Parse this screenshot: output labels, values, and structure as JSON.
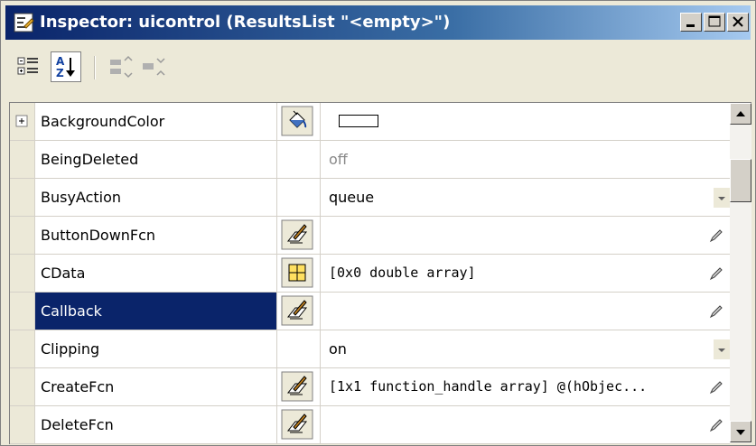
{
  "window": {
    "title": "Inspector:  uicontrol (ResultsList \"<empty>\")",
    "title_icon": "inspector-icon",
    "controls": [
      "minimize-icon",
      "maximize-icon",
      "close-icon"
    ]
  },
  "toolbar": {
    "buttons": [
      {
        "name": "categorized-view-icon",
        "pressed": false
      },
      {
        "name": "alphabetical-sort-icon",
        "pressed": true
      },
      {
        "name": "expand-all-icon",
        "pressed": false
      },
      {
        "name": "collapse-all-icon",
        "pressed": false
      }
    ]
  },
  "properties": [
    {
      "name": "BackgroundColor",
      "expander": "+",
      "icon": "paint-bucket-icon",
      "value": "",
      "swatch": "#ffffff"
    },
    {
      "name": "BeingDeleted",
      "icon": "",
      "value": "off",
      "value_style": "gray"
    },
    {
      "name": "BusyAction",
      "icon": "",
      "value": "queue",
      "dropdown": true
    },
    {
      "name": "ButtonDownFcn",
      "icon": "edit-callback-icon",
      "value": "",
      "pencil": true
    },
    {
      "name": "CData",
      "icon": "array-grid-icon",
      "value": "[0x0  double array]",
      "pencil": true,
      "mono": true
    },
    {
      "name": "Callback",
      "icon": "edit-callback-icon",
      "value": "",
      "pencil": true,
      "selected": true
    },
    {
      "name": "Clipping",
      "icon": "",
      "value": "on",
      "dropdown": true
    },
    {
      "name": "CreateFcn",
      "icon": "edit-callback-icon",
      "value": "[1x1  function_handle array] @(hObjec...",
      "pencil": true,
      "mono": true
    },
    {
      "name": "DeleteFcn",
      "icon": "edit-callback-icon",
      "value": "",
      "pencil": true
    }
  ],
  "colors": {
    "selection": "#0a246a",
    "title_start": "#0a246a",
    "title_end": "#a6caf0",
    "face": "#ece9d8"
  }
}
